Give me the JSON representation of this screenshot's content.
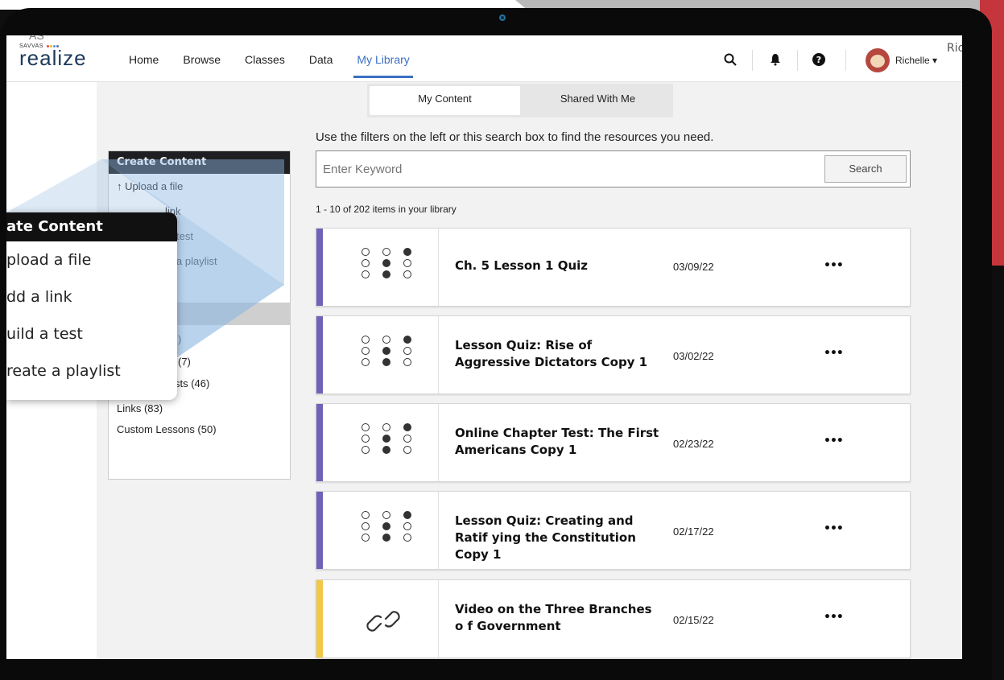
{
  "header": {
    "logo_brand": "SAVVAS",
    "logo_name": "realize",
    "nav": [
      {
        "label": "Home"
      },
      {
        "label": "Browse"
      },
      {
        "label": "Classes"
      },
      {
        "label": "Data"
      },
      {
        "label": "My Library"
      }
    ],
    "user_name": "Richelle ▾",
    "ghost_user": "Ric",
    "ghost_brand": "AS"
  },
  "tabs": [
    {
      "label": "My Content"
    },
    {
      "label": "Shared With Me"
    }
  ],
  "search": {
    "hint": "Use the filters on the left or this search box to find the resources you need.",
    "placeholder": "Enter Keyword",
    "button": "Search"
  },
  "results_count": "1 - 10 of 202 items in your library",
  "left_panel": {
    "create_heading": "Create Content",
    "upload": "↑ Upload a file",
    "link_frag": "link",
    "test_frag": "test",
    "playlist_frag": "a playlist",
    "filter_frags": [
      ")",
      "(7)",
      "sts (46)"
    ],
    "links": "Links (83)",
    "custom_lessons": "Custom Lessons (50)"
  },
  "zoom": {
    "heading": "ate Content",
    "items": [
      "pload a file",
      "dd a link",
      "uild a test",
      "reate a playlist"
    ]
  },
  "items": [
    {
      "title": "Ch. 5 Lesson 1 Quiz",
      "date": "03/09/22",
      "type": "assessment",
      "stripe": "#6e63b6",
      "more": "•••"
    },
    {
      "title": "Lesson Quiz: Rise of Aggressive Dictators Copy 1",
      "date": "03/02/22",
      "type": "assessment",
      "stripe": "#6e63b6",
      "more": "•••"
    },
    {
      "title": "Online Chapter Test: The First Americans Copy 1",
      "date": "02/23/22",
      "type": "assessment",
      "stripe": "#6e63b6",
      "more": "•••"
    },
    {
      "title": "Lesson Quiz: Creating and Ratif ying the Constitution Copy 1",
      "date": "02/17/22",
      "type": "assessment",
      "stripe": "#6e63b6",
      "more": "•••"
    },
    {
      "title": "Video on the Three Branches o f Government",
      "date": "02/15/22",
      "type": "link",
      "stripe": "#f2c84b",
      "more": "•••"
    }
  ],
  "colors": {
    "accent": "#3a6fc4",
    "assessment_stripe": "#6e63b6",
    "link_stripe": "#f2c84b",
    "panel_heading": "#1f1f23"
  }
}
